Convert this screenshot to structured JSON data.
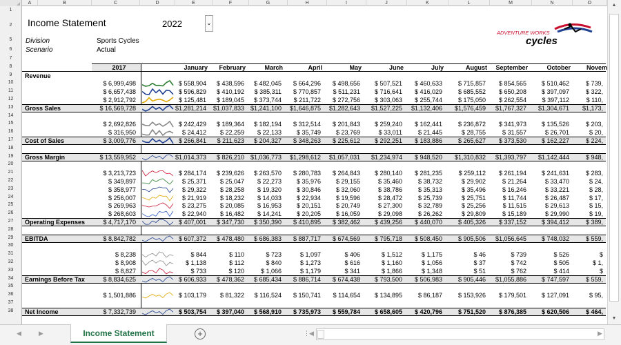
{
  "app": {
    "sheet_tab": "Income Statement",
    "add_sheet": "+"
  },
  "header": {
    "title": "Income Statement",
    "year": "2022",
    "division_label": "Division",
    "division_value": "Sports Cycles",
    "scenario_label": "Scenario",
    "scenario_value": "Actual"
  },
  "logo": {
    "line1": "ADVENTURE WORKS",
    "line2": "cycles",
    "accent": "#c8102e"
  },
  "columns": [
    "A",
    "B",
    "C",
    "D",
    "E",
    "F",
    "G",
    "H",
    "I",
    "J",
    "K",
    "L",
    "M",
    "N",
    "O"
  ],
  "table": {
    "col_year": "2017",
    "months": [
      "January",
      "February",
      "March",
      "April",
      "May",
      "June",
      "July",
      "August",
      "September",
      "October",
      "Novem"
    ],
    "rows": [
      {
        "r": 9,
        "label": "Revenue",
        "bold": true
      },
      {
        "r": 10,
        "ytd": "$ 6,999,498",
        "v": [
          "$ 558,904",
          "$ 438,596",
          "$ 482,045",
          "$ 664,296",
          "$ 498,656",
          "$ 507,521",
          "$ 460,633",
          "$ 715,857",
          "$ 854,565",
          "$ 510,462",
          "$ 739,"
        ]
      },
      {
        "r": 11,
        "ytd": "$ 6,657,438",
        "v": [
          "$ 596,829",
          "$ 410,192",
          "$ 385,311",
          "$ 770,857",
          "$ 511,231",
          "$ 716,641",
          "$ 416,029",
          "$ 685,552",
          "$ 650,208",
          "$ 397,097",
          "$ 322,"
        ]
      },
      {
        "r": 12,
        "ytd": "$ 2,912,792",
        "v": [
          "$ 125,481",
          "$ 189,045",
          "$ 373,744",
          "$ 211,722",
          "$ 272,756",
          "$ 303,063",
          "$ 255,744",
          "$ 175,050",
          "$ 262,554",
          "$ 397,112",
          "$ 110,"
        ]
      },
      {
        "r": 13,
        "label": "Gross Sales",
        "bold": true,
        "ytd": "$ 16,569,728",
        "v": [
          "$1,281,214",
          "$1,037,833",
          "$1,241,100",
          "$1,646,875",
          "$1,282,643",
          "$1,527,225",
          "$1,132,406",
          "$1,576,459",
          "$1,767,327",
          "$1,304,671",
          "$1,173,"
        ]
      },
      {
        "r": 14
      },
      {
        "r": 15,
        "ytd": "$ 2,692,826",
        "v": [
          "$ 242,429",
          "$ 189,364",
          "$ 182,194",
          "$ 312,514",
          "$ 201,843",
          "$ 259,240",
          "$ 162,441",
          "$ 236,872",
          "$ 341,973",
          "$ 135,526",
          "$ 203,"
        ]
      },
      {
        "r": 16,
        "ytd": "$ 316,950",
        "v": [
          "$ 24,412",
          "$ 22,259",
          "$ 22,133",
          "$ 35,749",
          "$ 23,769",
          "$ 33,011",
          "$ 21,445",
          "$ 28,755",
          "$ 31,557",
          "$ 26,701",
          "$ 20,"
        ]
      },
      {
        "r": 17,
        "label": "Cost of Sales",
        "bold": true,
        "ytd": "$ 3,009,776",
        "v": [
          "$ 266,841",
          "$ 211,623",
          "$ 204,327",
          "$ 348,263",
          "$ 225,612",
          "$ 292,251",
          "$ 183,886",
          "$ 265,627",
          "$ 373,530",
          "$ 162,227",
          "$ 224,"
        ]
      },
      {
        "r": 18
      },
      {
        "r": 19,
        "label": "Gross Margin",
        "bold": true,
        "ytd": "$ 13,559,952",
        "v": [
          "$1,014,373",
          "$ 826,210",
          "$1,036,773",
          "$1,298,612",
          "$1,057,031",
          "$1,234,974",
          "$ 948,520",
          "$1,310,832",
          "$1,393,797",
          "$1,142,444",
          "$ 948,"
        ]
      },
      {
        "r": 20
      },
      {
        "r": 21,
        "ytd": "$ 3,213,723",
        "v": [
          "$ 284,174",
          "$ 239,626",
          "$ 263,570",
          "$ 280,783",
          "$ 264,843",
          "$ 280,140",
          "$ 281,235",
          "$ 259,112",
          "$ 261,194",
          "$ 241,631",
          "$ 283,"
        ]
      },
      {
        "r": 22,
        "ytd": "$ 349,897",
        "v": [
          "$ 25,371",
          "$ 25,047",
          "$ 22,273",
          "$ 35,976",
          "$ 29,155",
          "$ 35,460",
          "$ 38,732",
          "$ 29,902",
          "$ 21,264",
          "$ 33,470",
          "$ 24,"
        ]
      },
      {
        "r": 23,
        "ytd": "$ 358,977",
        "v": [
          "$ 29,322",
          "$ 28,258",
          "$ 19,320",
          "$ 30,846",
          "$ 32,060",
          "$ 38,786",
          "$ 35,313",
          "$ 35,496",
          "$ 16,246",
          "$ 33,221",
          "$ 28,"
        ]
      },
      {
        "r": 24,
        "ytd": "$ 256,007",
        "v": [
          "$ 21,919",
          "$ 18,232",
          "$ 14,033",
          "$ 22,934",
          "$ 19,596",
          "$ 28,472",
          "$ 25,739",
          "$ 25,751",
          "$ 11,744",
          "$ 26,487",
          "$ 17,"
        ]
      },
      {
        "r": 25,
        "ytd": "$ 269,963",
        "v": [
          "$ 23,275",
          "$ 20,085",
          "$ 16,953",
          "$ 20,151",
          "$ 20,749",
          "$ 27,300",
          "$ 32,789",
          "$ 25,256",
          "$ 11,515",
          "$ 29,613",
          "$ 15,"
        ]
      },
      {
        "r": 26,
        "ytd": "$ 268,603",
        "v": [
          "$ 22,940",
          "$ 16,482",
          "$ 14,241",
          "$ 20,205",
          "$ 16,059",
          "$ 29,098",
          "$ 26,262",
          "$ 29,809",
          "$ 15,189",
          "$ 29,990",
          "$ 19,"
        ]
      },
      {
        "r": 27,
        "label": "Operating Expenses",
        "bold": true,
        "ytd": "$ 4,717,170",
        "v": [
          "$ 407,001",
          "$ 347,730",
          "$ 350,390",
          "$ 410,895",
          "$ 382,462",
          "$ 439,256",
          "$ 440,070",
          "$ 405,326",
          "$ 337,152",
          "$ 394,412",
          "$ 389,"
        ]
      },
      {
        "r": 28
      },
      {
        "r": 29,
        "label": "EBITDA",
        "bold": true,
        "ytd": "$ 8,842,782",
        "v": [
          "$ 607,372",
          "$ 478,480",
          "$ 686,383",
          "$ 887,717",
          "$ 674,569",
          "$ 795,718",
          "$ 508,450",
          "$ 905,506",
          "$1,056,645",
          "$ 748,032",
          "$ 559,"
        ]
      },
      {
        "r": 30
      },
      {
        "r": 31,
        "ytd": "$ 8,238",
        "v": [
          "$ 844",
          "$ 110",
          "$ 723",
          "$ 1,097",
          "$ 406",
          "$ 1,512",
          "$ 1,175",
          "$ 46",
          "$ 739",
          "$ 526",
          "$"
        ]
      },
      {
        "r": 32,
        "ytd": "$ 8,908",
        "v": [
          "$ 1,138",
          "$ 112",
          "$ 840",
          "$ 1,273",
          "$ 616",
          "$ 1,160",
          "$ 1,056",
          "$ 37",
          "$ 742",
          "$ 505",
          "$ 1,"
        ]
      },
      {
        "r": 33,
        "ytd": "$ 8,827",
        "v": [
          "$ 733",
          "$ 120",
          "$ 1,066",
          "$ 1,179",
          "$ 341",
          "$ 1,866",
          "$ 1,348",
          "$ 51",
          "$ 762",
          "$ 414",
          "$"
        ]
      },
      {
        "r": 34,
        "label": "Earnings Before Tax",
        "bold": true,
        "ytd": "$ 8,834,625",
        "v": [
          "$ 606,933",
          "$ 478,362",
          "$ 685,434",
          "$ 886,714",
          "$ 674,438",
          "$ 793,500",
          "$ 506,983",
          "$ 905,446",
          "$1,055,886",
          "$ 747,597",
          "$ 559,"
        ]
      },
      {
        "r": 35
      },
      {
        "r": 36,
        "ytd": "$ 1,501,886",
        "v": [
          "$ 103,179",
          "$ 81,322",
          "$ 116,524",
          "$ 150,741",
          "$ 114,654",
          "$ 134,895",
          "$ 86,187",
          "$ 153,926",
          "$ 179,501",
          "$ 127,091",
          "$ 95,"
        ]
      },
      {
        "r": 37
      },
      {
        "r": 38,
        "label": "Net Income",
        "bold": true,
        "ytd": "$ 7,332,739",
        "v": [
          "$ 503,754",
          "$ 397,040",
          "$ 568,910",
          "$ 735,973",
          "$ 559,784",
          "$ 658,605",
          "$ 420,796",
          "$ 751,520",
          "$ 876,385",
          "$ 620,506",
          "$ 464,"
        ]
      }
    ]
  }
}
